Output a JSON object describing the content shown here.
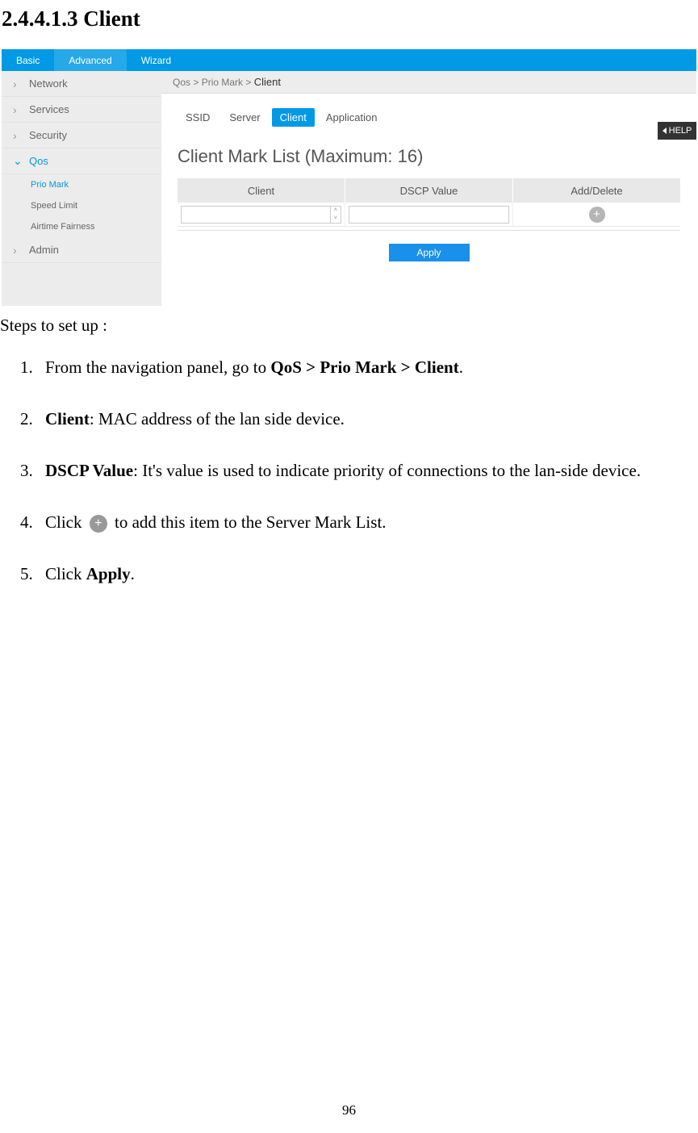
{
  "heading": "2.4.4.1.3 Client",
  "screenshot": {
    "top_nav": [
      "Basic",
      "Advanced",
      "Wizard"
    ],
    "top_nav_active": 1,
    "sidebar": {
      "items": [
        {
          "label": "Network",
          "expanded": false
        },
        {
          "label": "Services",
          "expanded": false
        },
        {
          "label": "Security",
          "expanded": false
        },
        {
          "label": "Qos",
          "expanded": true,
          "children": [
            {
              "label": "Prio Mark",
              "active": true
            },
            {
              "label": "Speed Limit",
              "active": false
            },
            {
              "label": "Airtime Fairness",
              "active": false
            }
          ]
        },
        {
          "label": "Admin",
          "expanded": false
        }
      ]
    },
    "breadcrumb": {
      "parts": [
        "Qos",
        "Prio Mark"
      ],
      "current": "Client"
    },
    "tabs": [
      "SSID",
      "Server",
      "Client",
      "Application"
    ],
    "tabs_active": 2,
    "section_title": "Client Mark List (Maximum: 16)",
    "table": {
      "headers": [
        "Client",
        "DSCP Value",
        "Add/Delete"
      ]
    },
    "apply_label": "Apply",
    "help_label": "HELP"
  },
  "body": {
    "intro": "Steps to set up :",
    "steps": {
      "s1_a": "From the navigation panel, go to ",
      "s1_b": "QoS > Prio Mark > Client",
      "s1_c": ".",
      "s2_a": "Client",
      "s2_b": ": MAC address of the lan side device.",
      "s3_a": "DSCP Value",
      "s3_b": ": It's value is used to indicate priority of connections to the lan-side device.",
      "s4_a": "Click ",
      "s4_b": " to add this item to the Server Mark List.",
      "s5_a": "Click ",
      "s5_b": "Apply",
      "s5_c": "."
    }
  },
  "page_number": "96"
}
